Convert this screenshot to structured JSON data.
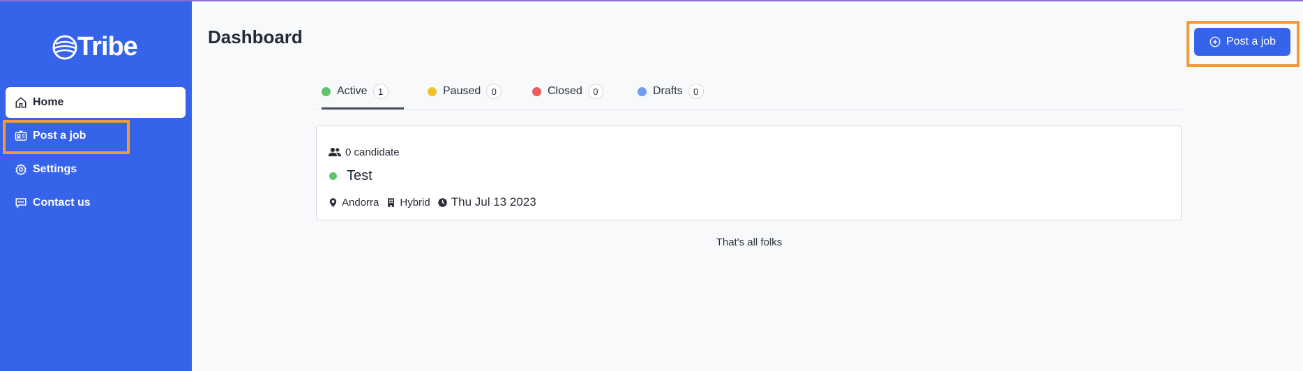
{
  "brand": {
    "name": "Tribe"
  },
  "sidebar": {
    "items": [
      {
        "label": "Home",
        "icon": "home-icon",
        "active": true
      },
      {
        "label": "Post a job",
        "icon": "id-card-icon",
        "active": false
      },
      {
        "label": "Settings",
        "icon": "gear-icon",
        "active": false
      },
      {
        "label": "Contact us",
        "icon": "chat-icon",
        "active": false
      }
    ]
  },
  "header": {
    "title": "Dashboard",
    "post_button_label": "Post a job"
  },
  "tabs": [
    {
      "label": "Active",
      "count": "1",
      "color": "#5cc569"
    },
    {
      "label": "Paused",
      "count": "0",
      "color": "#f2c12e"
    },
    {
      "label": "Closed",
      "count": "0",
      "color": "#ec5d5d"
    },
    {
      "label": "Drafts",
      "count": "0",
      "color": "#6e9cf0"
    }
  ],
  "job": {
    "candidates": "0 candidate",
    "title": "Test",
    "status_color": "#5cc569",
    "location": "Andorra",
    "workplace": "Hybrid",
    "date": "Thu Jul 13 2023"
  },
  "footer_note": "That's all folks",
  "colors": {
    "accent": "#3563e9",
    "highlight": "#f29a3a"
  }
}
